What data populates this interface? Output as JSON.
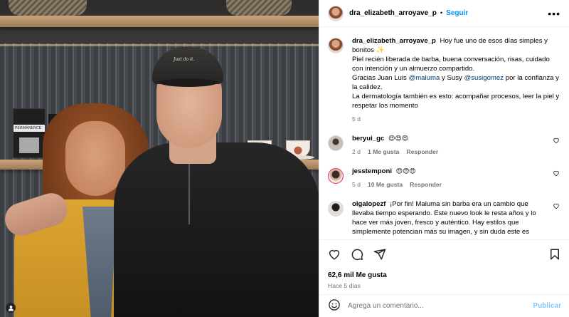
{
  "header": {
    "username": "dra_elizabeth_arroyave_p",
    "separator": "•",
    "follow_label": "Seguir",
    "more_label": "•••"
  },
  "photo": {
    "cap_text": "Just do it.",
    "box_text": "PERMANENCE"
  },
  "caption": {
    "username": "dra_elizabeth_arroyave_p",
    "line1": "Hoy fue uno de esos días simples y bonitos ✨",
    "line2": "Piel recién liberada de barba, buena conversación, risas, cuidado con intención y un almuerzo compartido.",
    "line3_prefix": "Gracias Juan Luis ",
    "mention1": "@maluma",
    "line3_mid": " y Susy ",
    "mention2": "@susigomez",
    "line3_suffix": " por la confianza y la calidez.",
    "line4": "La dermatología también es esto: acompañar procesos, leer la piel y respetar los momento",
    "time": "5 d"
  },
  "comments": [
    {
      "username": "beryui_gc",
      "text": "😍😍😍",
      "time": "2 d",
      "likes": "1 Me gusta",
      "reply": "Responder"
    },
    {
      "username": "jesstemponi",
      "text": "😍😍😍",
      "time": "5 d",
      "likes": "10 Me gusta",
      "reply": "Responder"
    },
    {
      "username": "olgalopezf",
      "text": "¡Por fin! Maluma sin barba era un cambio que llevaba tiempo esperando. Este nuevo look le resta años y lo hace ver más joven, fresco y auténtico. Hay estilos que simplemente potencian más su imagen, y sin duda este es"
    }
  ],
  "actions": {
    "likes_count": "62,6 mil Me gusta",
    "posted_ago": "Hace 5 días"
  },
  "add_comment": {
    "placeholder": "Agrega un comentario...",
    "post_label": "Publicar"
  },
  "colors": {
    "accent": "#0095f6",
    "mention": "#00376b",
    "muted": "#737373",
    "border": "#efefef"
  }
}
